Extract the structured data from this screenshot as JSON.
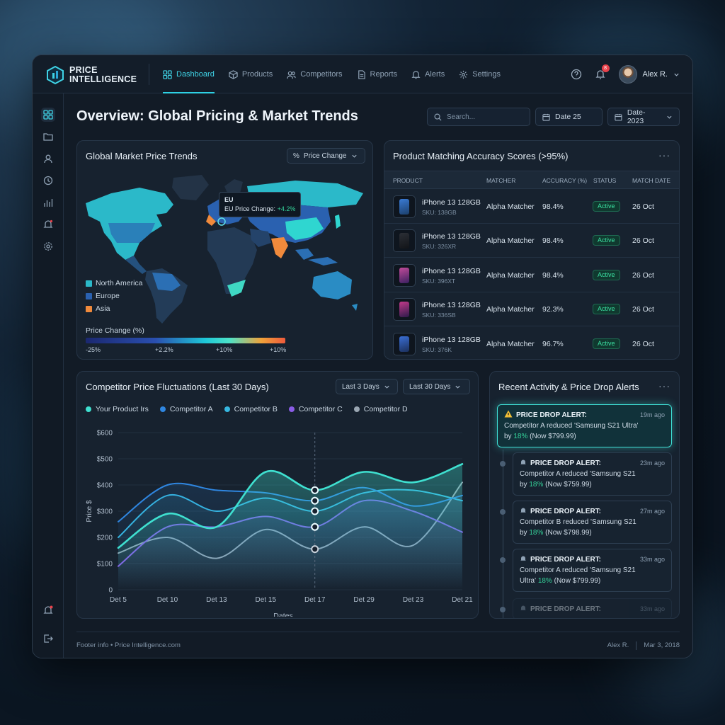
{
  "app": {
    "brand_line1": "PRICE",
    "brand_line2": "INTELLIGENCE"
  },
  "nav": [
    {
      "label": "Dashboard",
      "icon": "grid-icon",
      "active": true
    },
    {
      "label": "Products",
      "icon": "cube-icon"
    },
    {
      "label": "Competitors",
      "icon": "users-icon"
    },
    {
      "label": "Reports",
      "icon": "document-icon"
    },
    {
      "label": "Alerts",
      "icon": "bell-icon"
    },
    {
      "label": "Settings",
      "icon": "gear-icon"
    }
  ],
  "topbar": {
    "notification_count": "8",
    "user_name": "Alex R."
  },
  "page": {
    "title": "Overview: Global Pricing & Market Trends"
  },
  "filters": {
    "search_placeholder": "Search...",
    "date1": "Date 25",
    "date2": "Date-2023"
  },
  "map_card": {
    "title": "Global Market Price Trends",
    "dropdown": "Price Change",
    "tooltip_title": "EU",
    "tooltip_label": "EU Price Change:",
    "tooltip_value": "+4.2%",
    "legend": [
      {
        "label": "North America",
        "color": "#2bb9c9"
      },
      {
        "label": "Europe",
        "color": "#2a61b0"
      },
      {
        "label": "Asia",
        "color": "#f08a3c"
      }
    ],
    "scale_title": "Price Change (%)",
    "scale_labels": [
      "-25%",
      "+2.2%",
      "+10%",
      "+10%"
    ]
  },
  "matching_card": {
    "title": "Product Matching Accuracy Scores (>95%)",
    "columns": [
      "PRODUCT",
      "MATCHER",
      "ACCURACY (%)",
      "STATUS",
      "MATCH DATE"
    ],
    "rows": [
      {
        "name": "iPhone 13 128GB",
        "sku": "SKU: 138GB",
        "matcher": "Alpha Matcher",
        "accuracy": "98.4%",
        "status": "Active",
        "date": "26 Oct"
      },
      {
        "name": "iPhone 13 128GB",
        "sku": "SKU: 326XR",
        "matcher": "Alpha Matcher",
        "accuracy": "98.4%",
        "status": "Active",
        "date": "26 Oct"
      },
      {
        "name": "iPhone 13 128GB",
        "sku": "SKU: 396XT",
        "matcher": "Alpha Matcher",
        "accuracy": "98.4%",
        "status": "Active",
        "date": "26 Oct"
      },
      {
        "name": "iPhone 13 128GB",
        "sku": "SKU: 336SB",
        "matcher": "Alpha Matcher",
        "accuracy": "92.3%",
        "status": "Active",
        "date": "26 Oct"
      },
      {
        "name": "iPhone 13 128GB",
        "sku": "SKU: 376K",
        "matcher": "Alpha Matcher",
        "accuracy": "96.7%",
        "status": "Active",
        "date": "26 Oct"
      }
    ]
  },
  "chart_card": {
    "title": "Competitor Price Fluctuations (Last 30 Days)",
    "dropdown1": "Last 3 Days",
    "dropdown2": "Last 30 Days"
  },
  "chart_data": {
    "type": "area",
    "xlabel": "Dates",
    "ylabel": "Price $",
    "ylim": [
      0,
      600
    ],
    "yticks": [
      "0",
      "$100",
      "$200",
      "$300",
      "$400",
      "$500",
      "$600"
    ],
    "x": [
      "Det 5",
      "Det 10",
      "Det 13",
      "Det 15",
      "Det 17",
      "Det 29",
      "Det 23",
      "Det 21"
    ],
    "legend_placement": "top",
    "highlight_x": "Det 17",
    "series": [
      {
        "name": "Your Product Irs",
        "color": "#3fe0d0",
        "values": [
          160,
          290,
          240,
          450,
          380,
          450,
          410,
          480
        ]
      },
      {
        "name": "Competitor A",
        "color": "#2f86e0",
        "values": [
          260,
          400,
          380,
          370,
          340,
          390,
          320,
          360
        ]
      },
      {
        "name": "Competitor B",
        "color": "#36b7e0",
        "values": [
          200,
          360,
          300,
          350,
          300,
          370,
          380,
          340
        ]
      },
      {
        "name": "Competitor C",
        "color": "#8a5ce6",
        "values": [
          90,
          240,
          240,
          280,
          240,
          340,
          300,
          220
        ]
      },
      {
        "name": "Competitor D",
        "color": "#9aa6b2",
        "values": [
          140,
          200,
          120,
          230,
          155,
          240,
          170,
          410
        ]
      }
    ]
  },
  "alerts_card": {
    "title": "Recent Activity & Price Drop Alerts",
    "alerts": [
      {
        "title": "PRICE DROP ALERT:",
        "time": "19m ago",
        "line1": "Competitor A reduced 'Samsung S21 Ultra'",
        "line2_pre": "by",
        "pct": "18%",
        "line2_post": "(Now $799.99)"
      },
      {
        "title": "PRICE DROP ALERT:",
        "time": "23m ago",
        "line1": "Competitor A reduced 'Samsung S21",
        "line2_pre": "by",
        "pct": "18%",
        "line2_post": "(Now $759.99)"
      },
      {
        "title": "PRICE DROP ALERT:",
        "time": "27m ago",
        "line1": "Competitor B reduced 'Samsung S21",
        "line2_pre": "by",
        "pct": "18%",
        "line2_post": "(Now $798.99)"
      },
      {
        "title": "PRICE DROP ALERT:",
        "time": "33m ago",
        "line1": "Competitor A reduced 'Samsung S21",
        "line2_pre": "Ultra'",
        "pct": "18%",
        "line2_post": "(Now $799.99)"
      },
      {
        "title": "PRICE DROP ALERT:",
        "time": "33m ago",
        "line1": "",
        "line2_pre": "",
        "pct": "",
        "line2_post": ""
      }
    ]
  },
  "footer": {
    "left": "Footer info  •  Price Intelligence.com",
    "user": "Alex R.",
    "date": "Mar 3, 2018"
  }
}
